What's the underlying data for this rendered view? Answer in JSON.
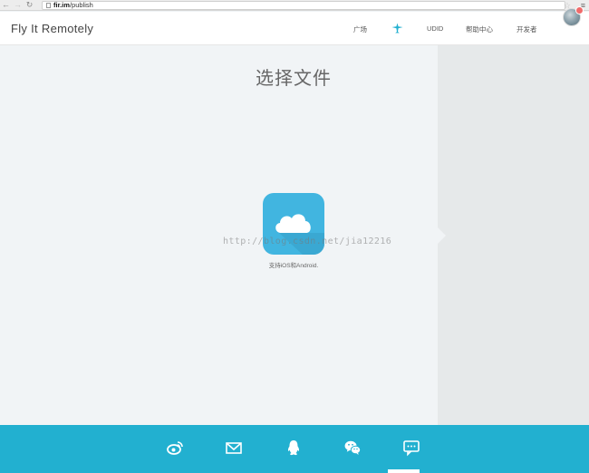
{
  "browser": {
    "back": "←",
    "forward": "→",
    "reload": "↻",
    "url_host": "fir.im",
    "url_path": "/publish",
    "star": "☆",
    "menu": "≡"
  },
  "header": {
    "brand": "Fly It Remotely",
    "nav": [
      {
        "label": "广场"
      },
      {
        "icon": "plane-icon"
      },
      {
        "label": "UDID"
      },
      {
        "label": "帮助中心"
      },
      {
        "label": "开发者"
      }
    ],
    "accent_color": "#22b0d0"
  },
  "main": {
    "title": "选择文件",
    "support_text": "支持iOS和Android.",
    "watermark": "http://blog.csdn.net/jia12216",
    "upload_icon": "cloud-upload-icon",
    "tile_color": "#41b5e0"
  },
  "footer": {
    "color": "#22b0d0",
    "icons": [
      "weibo-icon",
      "mail-icon",
      "qq-icon",
      "wechat-icon",
      "chat-icon"
    ]
  }
}
